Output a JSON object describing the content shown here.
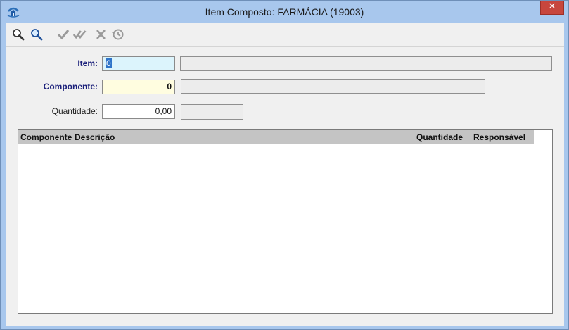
{
  "window": {
    "title": "Item Composto: FARMÁCIA (19003)",
    "close_glyph": "✕"
  },
  "toolbar": {
    "buttons": [
      "search-icon",
      "search-next-icon",
      "confirm-icon",
      "confirm-all-icon",
      "cancel-icon",
      "history-icon"
    ]
  },
  "form": {
    "item": {
      "label": "Item:",
      "value": "0",
      "description": ""
    },
    "componente": {
      "label": "Componente:",
      "value": "0",
      "description": ""
    },
    "quantidade": {
      "label": "Quantidade:",
      "value": "0,00",
      "unit": ""
    }
  },
  "grid": {
    "columns": [
      "Componente",
      "Descrição",
      "Quantidade",
      "Responsável"
    ],
    "rows": []
  },
  "colors": {
    "window_frame": "#a8c7ed",
    "close_button": "#c7463d",
    "item_field_bg": "#dcf4fc",
    "componente_field_bg": "#fffde0",
    "label_accent": "#1a1f7a",
    "grid_header_bg": "#c4c4c4"
  }
}
